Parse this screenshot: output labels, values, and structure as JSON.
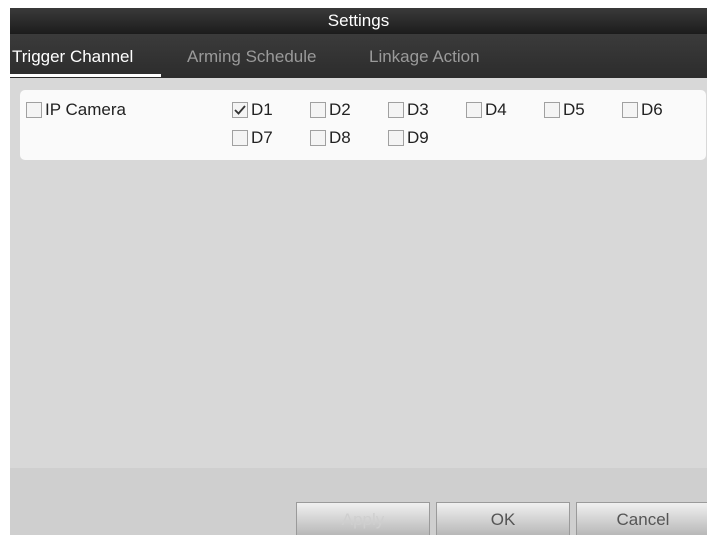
{
  "window": {
    "title": "Settings"
  },
  "tabs": [
    {
      "label": "Trigger Channel",
      "active": true
    },
    {
      "label": "Arming Schedule",
      "active": false
    },
    {
      "label": "Linkage Action",
      "active": false
    }
  ],
  "group": {
    "label": "IP Camera",
    "checked": false
  },
  "channels": [
    {
      "label": "D1",
      "checked": true
    },
    {
      "label": "D2",
      "checked": false
    },
    {
      "label": "D3",
      "checked": false
    },
    {
      "label": "D4",
      "checked": false
    },
    {
      "label": "D5",
      "checked": false
    },
    {
      "label": "D6",
      "checked": false
    },
    {
      "label": "D7",
      "checked": false
    },
    {
      "label": "D8",
      "checked": false
    },
    {
      "label": "D9",
      "checked": false
    }
  ],
  "buttons": {
    "apply_label": "Apply",
    "apply_enabled": false,
    "ok_label": "OK",
    "cancel_label": "Cancel"
  },
  "icons": {
    "check": "checkmark-icon",
    "unchecked": "empty-checkbox-icon"
  }
}
